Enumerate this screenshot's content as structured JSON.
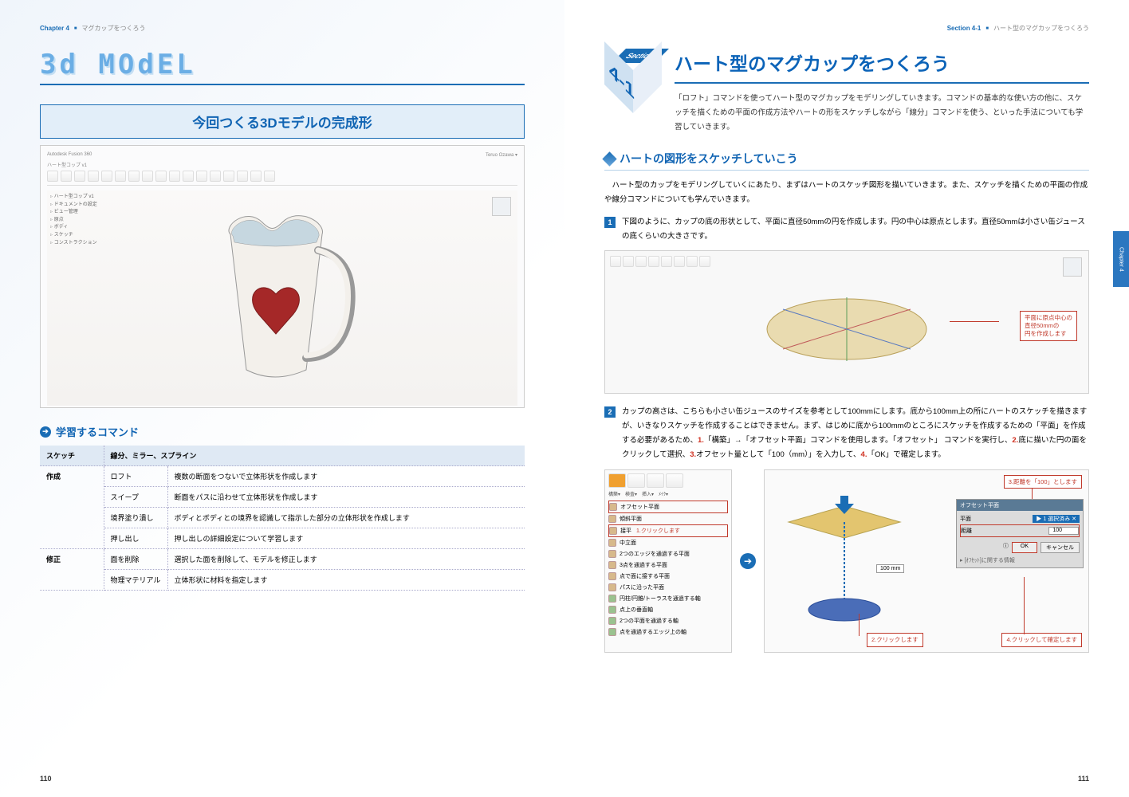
{
  "left_header": {
    "chapter": "Chapter 4",
    "sub": "マグカップをつくろう"
  },
  "right_header": {
    "section": "Section 4-1",
    "sub": "ハート型のマグカップをつくろう"
  },
  "page_left_num": "110",
  "page_right_num": "111",
  "logo": "3d MOdEL",
  "title_box": "今回つくる3Dモデルの完成形",
  "app": {
    "title_left": "Autodesk Fusion 360",
    "title_right": "Teruo Ozawa ▾",
    "tab": "ハート型コップ v1",
    "browser": [
      "ハート型コップ v1",
      "ドキュメントの設定",
      "ビュー管理",
      "原点",
      "ボディ",
      "スケッチ",
      "コンストラクション"
    ]
  },
  "cmd_head": "学習するコマンド",
  "table": {
    "h1": "スケッチ",
    "h1v": "線分、ミラー、スプライン",
    "cat1": "作成",
    "r1a": "ロフト",
    "r1b": "複数の断面をつないで立体形状を作成します",
    "r2a": "スイープ",
    "r2b": "断面をパスに沿わせて立体形状を作成します",
    "r3a": "境界塗り潰し",
    "r3b": "ボディとボディとの境界を認識して指示した部分の立体形状を作成します",
    "r4a": "押し出し",
    "r4b": "押し出しの詳細設定について学習します",
    "cat2": "修正",
    "r5a": "面を削除",
    "r5b": "選択した面を削除して、モデルを修正します",
    "r6a": "物理マテリアル",
    "r6b": "立体形状に材料を指定します"
  },
  "section": {
    "badge": "Section",
    "num": "4-1"
  },
  "section_title": "ハート型のマグカップをつくろう",
  "section_lead": "「ロフト」コマンドを使ってハート型のマグカップをモデリングしていきます。コマンドの基本的な使い方の他に、スケッチを描くための平面の作成方法やハートの形をスケッチしながら「線分」コマンドを使う、といった手法についても学習していきます。",
  "sub1": "ハートの図形をスケッチしていこう",
  "p1": "ハート型のカップをモデリングしていくにあたり、まずはハートのスケッチ図形を描いていきます。また、スケッチを描くための平面の作成や線分コマンドについても学んでいきます。",
  "step1": {
    "n": "1",
    "text": "下図のように、カップの底の形状として、平面に直径50mmの円を作成します。円の中心は原点とします。直径50mmは小さい缶ジュースの底くらいの大きさです。"
  },
  "callout1": "平面に原点中心の\n直径50mmの\n円を作成します",
  "step2": {
    "n": "2",
    "t1": "カップの高さは、こちらも小さい缶ジュースのサイズを参考として100mmにします。底から100mm上の所にハートのスケッチを描きますが、いきなりスケッチを作成することはできません。まず、はじめに底から100mmのところにスケッチを作成するための「平面」を作成する必要があるため、",
    "r1": "1.",
    "t2": "「構築」→「オフセット平面」コマンドを使用します。「オフセット」 コマンドを実行し、",
    "r2": "2.",
    "t3": "底に描いた円の面をクリックして選択、",
    "r3": "3.",
    "t4": "オフセット量として「100（mm）」を入力して、",
    "r4": "4.",
    "t5": "「OK」で確定します。"
  },
  "menu": {
    "tabs": [
      "構築▾",
      "検査▾",
      "挿入▾",
      "ﾒｲｸ▾"
    ],
    "m1": "オフセット平面",
    "m2": "傾斜平面",
    "m3": "接平",
    "m4": "中立面",
    "m5": "2つのエッジを通過する平面",
    "m6": "3点を通過する平面",
    "m7": "点で面に接する平面",
    "m8": "パスに沿った平面",
    "m9": "円柱/円錐/トーラスを通過する軸",
    "m10": "点上の垂直軸",
    "m11": "2つの平面を通過する軸",
    "m12": "点を通過するエッジ上の軸"
  },
  "c_click1": "1.クリックします",
  "c_dist": "3.距離を「100」とします",
  "c_click2": "2.クリックします",
  "c_click4": "4.クリックして確定します",
  "panel": {
    "title": "オフセット平面",
    "row1a": "平面",
    "row1b": "1 選択済み",
    "row2a": "距離",
    "row2b": "100",
    "ok": "OK",
    "cancel": "キャンセル",
    "link": "[ｵﾌｾｯﾄ]に関する情報",
    "dim": "100 mm"
  },
  "side_tab": "Chapter 4"
}
